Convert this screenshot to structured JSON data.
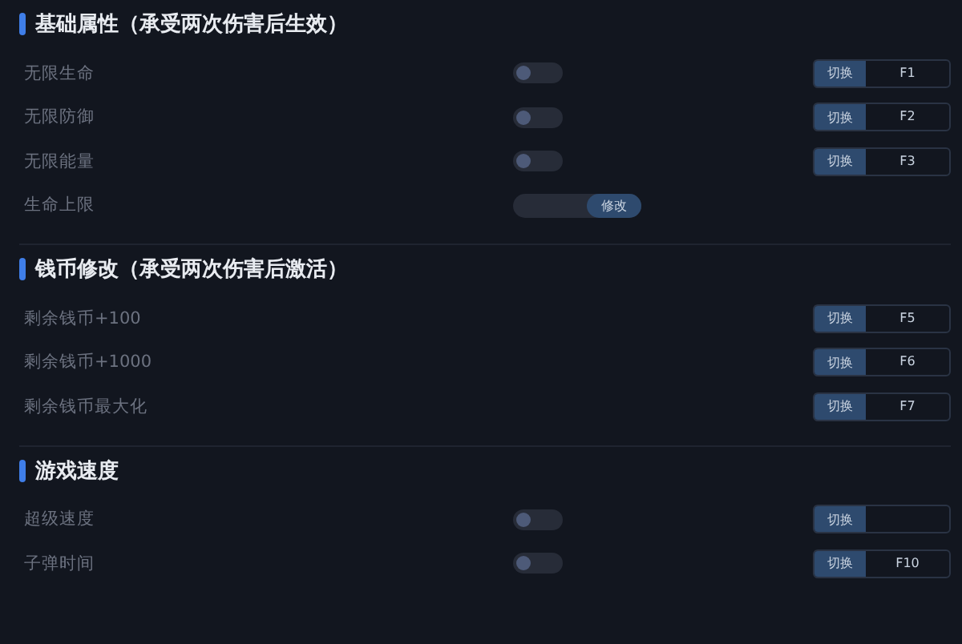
{
  "sections": [
    {
      "title": "基础属性（承受两次伤害后生效）",
      "rows": [
        {
          "kind": "toggle",
          "label": "无限生命",
          "on": false,
          "hotkey": {
            "label": "切换",
            "key": "F1"
          }
        },
        {
          "kind": "toggle",
          "label": "无限防御",
          "on": false,
          "hotkey": {
            "label": "切换",
            "key": "F2"
          }
        },
        {
          "kind": "toggle",
          "label": "无限能量",
          "on": false,
          "hotkey": {
            "label": "切换",
            "key": "F3"
          }
        },
        {
          "kind": "input",
          "label": "生命上限",
          "button": "修改"
        }
      ]
    },
    {
      "title": "钱币修改（承受两次伤害后激活）",
      "rows": [
        {
          "kind": "hotkey",
          "label": "剩余钱币+100",
          "hotkey": {
            "label": "切换",
            "key": "F5"
          }
        },
        {
          "kind": "hotkey",
          "label": "剩余钱币+1000",
          "hotkey": {
            "label": "切换",
            "key": "F6"
          }
        },
        {
          "kind": "hotkey",
          "label": "剩余钱币最大化",
          "hotkey": {
            "label": "切换",
            "key": "F7"
          }
        }
      ]
    },
    {
      "title": "游戏速度",
      "rows": [
        {
          "kind": "toggle",
          "label": "超级速度",
          "on": false,
          "hotkey": {
            "label": "切换"
          }
        },
        {
          "kind": "toggle",
          "label": "子弹时间",
          "on": false,
          "hotkey": {
            "label": "切换",
            "key": "F10"
          }
        }
      ]
    }
  ]
}
